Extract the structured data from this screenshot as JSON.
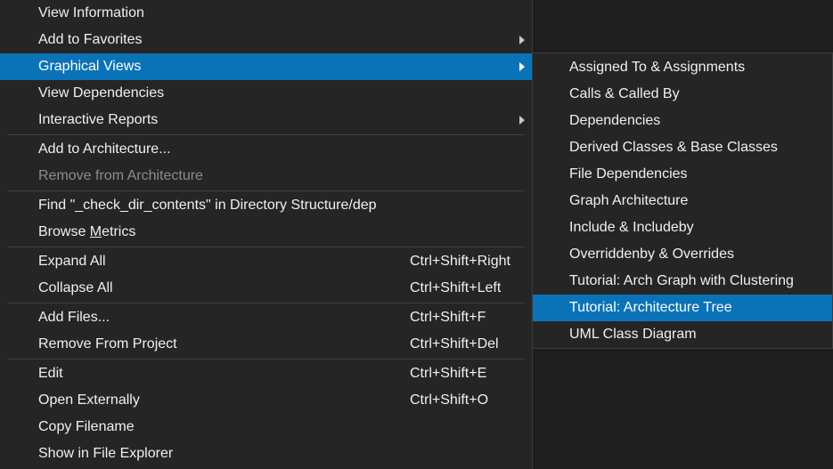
{
  "menu": {
    "groups": [
      [
        {
          "label": "View Information",
          "shortcut": "",
          "submenu": false,
          "state": "normal"
        },
        {
          "label": "Add to Favorites",
          "shortcut": "",
          "submenu": true,
          "state": "normal"
        },
        {
          "label": "Graphical Views",
          "shortcut": "",
          "submenu": true,
          "state": "selected"
        },
        {
          "label": "View Dependencies",
          "shortcut": "",
          "submenu": false,
          "state": "normal"
        },
        {
          "label": "Interactive Reports",
          "shortcut": "",
          "submenu": true,
          "state": "normal"
        }
      ],
      [
        {
          "label": "Add to Architecture...",
          "shortcut": "",
          "submenu": false,
          "state": "normal"
        },
        {
          "label": "Remove from Architecture",
          "shortcut": "",
          "submenu": false,
          "state": "disabled"
        }
      ],
      [
        {
          "label": "Find \"_check_dir_contents\" in Directory Structure/dep",
          "shortcut": "",
          "submenu": false,
          "state": "normal"
        },
        {
          "label": "Browse Metrics",
          "shortcut": "",
          "submenu": false,
          "state": "normal"
        }
      ],
      [
        {
          "label": "Expand All",
          "shortcut": "Ctrl+Shift+Right",
          "submenu": false,
          "state": "normal"
        },
        {
          "label": "Collapse All",
          "shortcut": "Ctrl+Shift+Left",
          "submenu": false,
          "state": "normal"
        }
      ],
      [
        {
          "label": "Add Files...",
          "shortcut": "Ctrl+Shift+F",
          "submenu": false,
          "state": "normal"
        },
        {
          "label": "Remove From Project",
          "shortcut": "Ctrl+Shift+Del",
          "submenu": false,
          "state": "normal"
        }
      ],
      [
        {
          "label": "Edit",
          "shortcut": "Ctrl+Shift+E",
          "submenu": false,
          "state": "normal"
        },
        {
          "label": "Open Externally",
          "shortcut": "Ctrl+Shift+O",
          "submenu": false,
          "state": "normal"
        },
        {
          "label": "Copy Filename",
          "shortcut": "",
          "submenu": false,
          "state": "normal"
        },
        {
          "label": "Show in File Explorer",
          "shortcut": "",
          "submenu": false,
          "state": "normal"
        }
      ]
    ]
  },
  "submenu": {
    "items": [
      {
        "label": "Assigned To & Assignments",
        "state": "normal"
      },
      {
        "label": "Calls & Called By",
        "state": "normal"
      },
      {
        "label": "Dependencies",
        "state": "normal"
      },
      {
        "label": "Derived Classes & Base Classes",
        "state": "normal"
      },
      {
        "label": "File Dependencies",
        "state": "normal"
      },
      {
        "label": "Graph Architecture",
        "state": "normal"
      },
      {
        "label": "Include & Includeby",
        "state": "normal"
      },
      {
        "label": "Overriddenby & Overrides",
        "state": "normal"
      },
      {
        "label": "Tutorial: Arch Graph with Clustering",
        "state": "normal"
      },
      {
        "label": "Tutorial: Architecture Tree",
        "state": "selected"
      },
      {
        "label": "UML Class Diagram",
        "state": "normal"
      }
    ]
  },
  "colors": {
    "menu_bg": "#252526",
    "selection": "#0a73b8",
    "text": "#f0f0f0",
    "disabled_text": "#8c8c8c"
  },
  "icons": {
    "submenu_arrow": "chevron-right-icon"
  }
}
